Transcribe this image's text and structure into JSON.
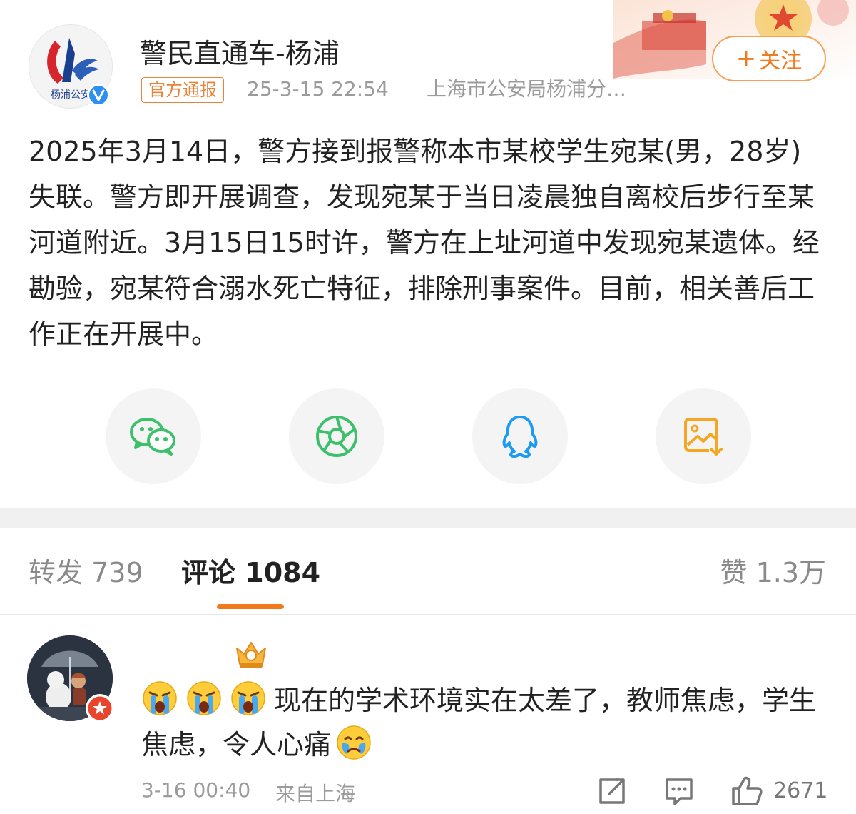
{
  "header": {
    "username": "警民直通车-杨浦",
    "avatar_text": "杨浦公安",
    "badge": "官方通报",
    "time": "25-3-15 22:54",
    "source": "上海市公安局杨浦分…",
    "follow_plus": "+",
    "follow_label": "关注"
  },
  "post": {
    "text": "2025年3月14日，警方接到报警称本市某校学生宛某(男，28岁)失联。警方即开展调查，发现宛某于当日凌晨独自离校后步行至某河道附近。3月15日15时许，警方在上址河道中发现宛某遗体。经勘验，宛某符合溺水死亡特征，排除刑事案件。目前，相关善后工作正在开展中。"
  },
  "share": [
    {
      "name": "wechat",
      "icon": "wechat-icon",
      "color": "#3dbf6c"
    },
    {
      "name": "moments",
      "icon": "moments-icon",
      "color": "#3dbf6c"
    },
    {
      "name": "qq",
      "icon": "qq-icon",
      "color": "#1e9bf0"
    },
    {
      "name": "save-image",
      "icon": "save-image-icon",
      "color": "#f5a623"
    }
  ],
  "tabs": {
    "repost_label": "转发",
    "repost_count": "739",
    "comments_label": "评论",
    "comments_count": "1084",
    "likes_label": "赞",
    "likes_count": "1.3万"
  },
  "comment": {
    "text": "现在的学术环境实在太差了，教师焦虑，学生焦虑，令人心痛",
    "time": "3-16 00:40",
    "location": "来自上海",
    "like_count": "2671"
  },
  "colors": {
    "accent": "#f07a1c",
    "meta_gray": "#9b9b9b",
    "verify_blue": "#2d8ff0"
  }
}
